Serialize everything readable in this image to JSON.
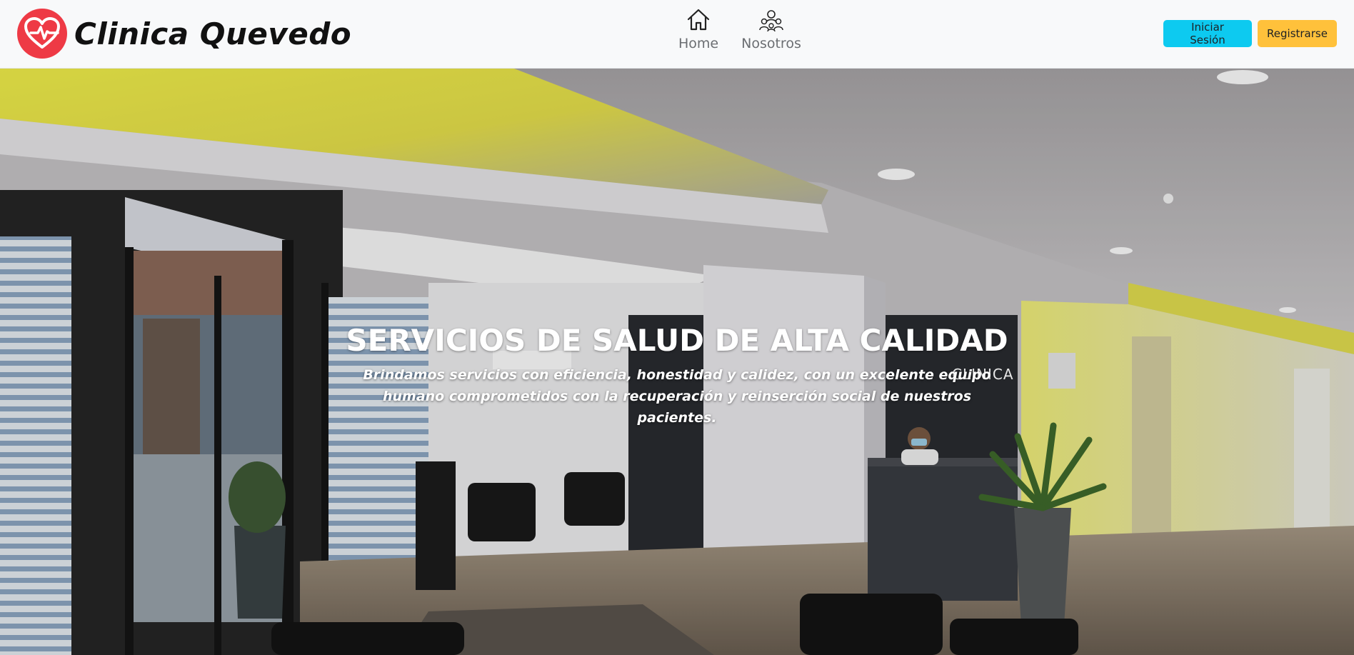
{
  "brand": {
    "name": "Clinica Quevedo",
    "logo_icon": "heart-pulse-icon",
    "logo_color": "#ee3a45"
  },
  "nav": {
    "items": [
      {
        "label": "Home",
        "icon": "house-icon"
      },
      {
        "label": "Nosotros",
        "icon": "people-icon"
      }
    ]
  },
  "auth": {
    "login_label": "Iniciar Sesión",
    "register_label": "Registrarse",
    "login_color": "#0dcaf0",
    "register_color": "#ffc13b"
  },
  "hero": {
    "title": "SERVICIOS DE SALUD DE ALTA CALIDAD",
    "subtitle": "Brindamos servicios con eficiencia, honestidad y calidez, con un excelente equipo humano comprometidos con la recuperación y reinserción social de nuestros pacientes.",
    "reception_sign": "CLINICA"
  }
}
